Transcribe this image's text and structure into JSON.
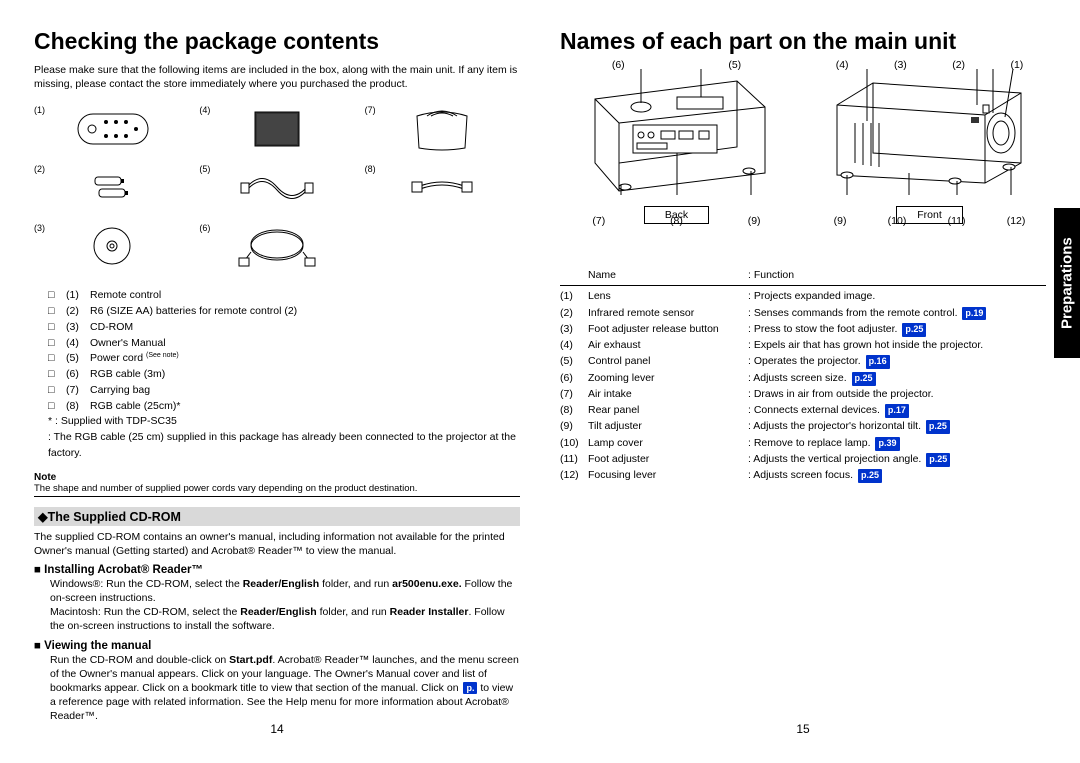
{
  "left": {
    "title": "Checking the package contents",
    "intro": "Please make sure that the following items are included in the box, along with the main unit. If any item is missing, please contact the store immediately where you purchased the product.",
    "item_nums": [
      "(1)",
      "(4)",
      "(7)",
      "(2)",
      "(5)",
      "(8)",
      "(3)",
      "(6)"
    ],
    "checklist": [
      {
        "n": "(1)",
        "t": "Remote control"
      },
      {
        "n": "(2)",
        "t": "R6 (SIZE AA) batteries for remote control (2)"
      },
      {
        "n": "(3)",
        "t": "CD-ROM"
      },
      {
        "n": "(4)",
        "t": "Owner's Manual"
      },
      {
        "n": "(5)",
        "t": "Power cord "
      },
      {
        "n": "(6)",
        "t": "RGB cable (3m)"
      },
      {
        "n": "(7)",
        "t": "Carrying bag"
      },
      {
        "n": "(8)",
        "t": "RGB cable (25cm)*"
      }
    ],
    "seenote": "(See note)",
    "supplied_note": "* : Supplied with TDP-SC35",
    "rgb_note": ": The RGB cable (25 cm) supplied in this package has already been connected to the projector at the factory.",
    "note_label": "Note",
    "note_text": "The shape and number of supplied power cords vary depending on the product destination.",
    "cdrom_head": "◆The Supplied CD-ROM",
    "cdrom_body": "The supplied CD-ROM contains an owner's manual, including information not available for the printed Owner's manual (Getting started) and Acrobat® Reader™ to view the manual.",
    "install_head": "Installing Acrobat® Reader™",
    "install_win_a": "Windows®: Run the CD-ROM, select the ",
    "install_win_b": "Reader/English",
    "install_win_c": " folder, and run ",
    "install_win_d": "ar500enu.exe.",
    "install_win_e": " Follow the on-screen instructions.",
    "install_mac_a": "Macintosh: Run the CD-ROM, select the ",
    "install_mac_b": "Reader/English",
    "install_mac_c": " folder, and run ",
    "install_mac_d": "Reader Installer",
    "install_mac_e": ". Follow the on-screen instructions to install the software.",
    "view_head": "Viewing the manual",
    "view_a": "Run the CD-ROM and double-click on ",
    "view_b": "Start.pdf",
    "view_c": ". Acrobat® Reader™ launches, and the menu screen of the Owner's manual appears. Click on your language. The Owner's Manual cover and list of bookmarks appear. Click on a bookmark title to view that section of the manual. Click on ",
    "view_d": " to view a reference page with related information. See the Help menu for more information about Acrobat® Reader™.",
    "pref_p": "p.",
    "page": "14"
  },
  "right": {
    "title": "Names of each part on the main unit",
    "back_top": [
      "(6)",
      "(5)"
    ],
    "back_bot": [
      "(7)",
      "(8)",
      "(9)"
    ],
    "front_top": [
      "(4)",
      "(3)",
      "(2)",
      "(1)"
    ],
    "front_bot": [
      "(9)",
      "(10)",
      "(11)",
      "(12)"
    ],
    "back_label": "Back",
    "front_label": "Front",
    "th_name": "Name",
    "th_func": ": Function",
    "parts": [
      {
        "n": "(1)",
        "name": "Lens",
        "func": ": Projects expanded image."
      },
      {
        "n": "(2)",
        "name": "Infrared remote sensor",
        "func": ": Senses commands from the remote control.",
        "p": "p.19"
      },
      {
        "n": "(3)",
        "name": "Foot adjuster release button",
        "func": ": Press to stow the foot adjuster.",
        "p": "p.25"
      },
      {
        "n": "(4)",
        "name": "Air exhaust",
        "func": ": Expels air that has grown hot inside the projector."
      },
      {
        "n": "(5)",
        "name": "Control panel",
        "func": ": Operates the projector.",
        "p": "p.16"
      },
      {
        "n": "(6)",
        "name": "Zooming lever",
        "func": ": Adjusts screen size.",
        "p": "p.25"
      },
      {
        "n": "(7)",
        "name": "Air intake",
        "func": ": Draws in air from outside the projector."
      },
      {
        "n": "(8)",
        "name": "Rear panel",
        "func": ": Connects external devices.",
        "p": "p.17"
      },
      {
        "n": "(9)",
        "name": "Tilt adjuster",
        "func": ": Adjusts the projector's horizontal tilt.",
        "p": "p.25"
      },
      {
        "n": "(10)",
        "name": "Lamp cover",
        "func": ": Remove to replace lamp.",
        "p": "p.39"
      },
      {
        "n": "(11)",
        "name": "Foot adjuster",
        "func": ": Adjusts the vertical projection angle.",
        "p": "p.25"
      },
      {
        "n": "(12)",
        "name": "Focusing lever",
        "func": ": Adjusts screen focus.",
        "p": "p.25"
      }
    ],
    "tab": "Preparations",
    "page": "15"
  }
}
